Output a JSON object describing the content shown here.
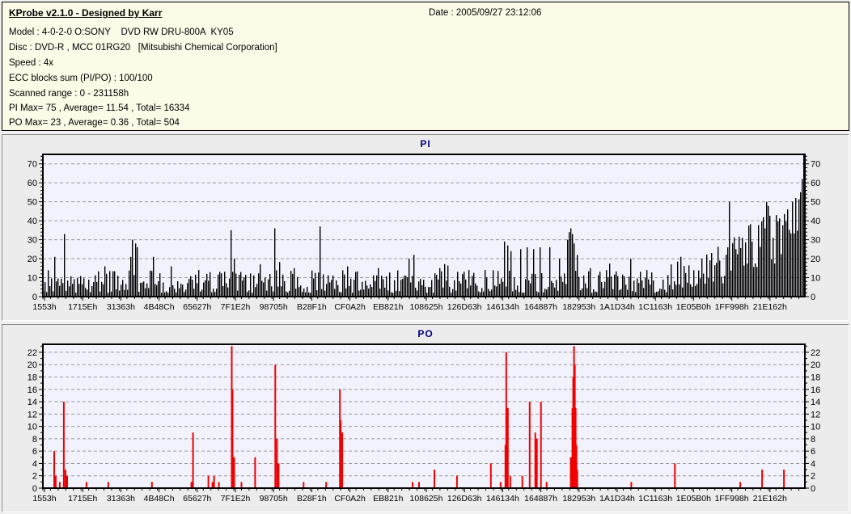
{
  "window": {
    "title": "KProbe v2.1.0 - Designed by Karr",
    "date_label": "Date : 2005/09/27 23:12:06"
  },
  "info": {
    "model": "Model : 4-0-2-0 O:SONY    DVD RW DRU-800A  KY05",
    "disc": "Disc : DVD-R , MCC 01RG20   [Mitsubishi Chemical Corporation]",
    "speed": "Speed : 4x",
    "ecc": "ECC blocks sum (PI/PO) : 100/100",
    "range": "Scanned range : 0 - 231158h",
    "pi_summary": "PI Max= 75 , Average= 11.54 , Total= 16334",
    "po_summary": "PO Max= 23 , Average= 0.36 , Total= 504"
  },
  "colors": {
    "info_bg": "#fbfbe7",
    "panel_bg": "#ececec",
    "plot_bg": "#f2f2fc",
    "grid": "#999999",
    "frame": "#000000",
    "title_navy": "#000080",
    "pi_bar": "#000000",
    "po_bar": "#f20000"
  },
  "chart_data": [
    {
      "type": "bar",
      "title": "PI",
      "bar_color": "#000000",
      "plot_bg": "#f2f2fc",
      "grid_color": "#999999",
      "ylim": [
        0,
        75
      ],
      "y_major_ticks": [
        0,
        10,
        20,
        30,
        40,
        50,
        60,
        70
      ],
      "y_minor_step": 2,
      "x_tick_labels": [
        "1553h",
        "1715Eh",
        "31363h",
        "4B48Ch",
        "65627h",
        "7F1E2h",
        "98705h",
        "B28F1h",
        "CF0A2h",
        "EB821h",
        "108625h",
        "126D63h",
        "146134h",
        "164887h",
        "182953h",
        "1A1D34h",
        "1C1163h",
        "1E05B0h",
        "1FF998h",
        "21E162h"
      ],
      "stats": {
        "max": 75,
        "average": 11.54,
        "total": 16334
      },
      "bar_count": 471,
      "noise_seed": 20050927,
      "burst_chance": 0.04,
      "burst_extra": 7,
      "baseline_segments": [
        {
          "from": 0.0,
          "to": 0.82,
          "min": [
            2,
            2
          ],
          "max": [
            14,
            14
          ],
          "pow": 1.4
        },
        {
          "from": 0.82,
          "to": 0.9,
          "min": [
            3,
            7
          ],
          "max": [
            16,
            30
          ],
          "pow": 1.1
        },
        {
          "from": 0.9,
          "to": 1.0,
          "min": [
            7,
            22
          ],
          "max": [
            32,
            55
          ],
          "pow": 0.9
        }
      ],
      "spikes": [
        [
          0.015,
          21
        ],
        [
          0.027,
          33
        ],
        [
          0.08,
          16
        ],
        [
          0.114,
          21
        ],
        [
          0.118,
          30
        ],
        [
          0.121,
          28
        ],
        [
          0.123,
          26
        ],
        [
          0.145,
          21
        ],
        [
          0.169,
          16
        ],
        [
          0.205,
          14
        ],
        [
          0.246,
          35
        ],
        [
          0.252,
          20
        ],
        [
          0.286,
          17
        ],
        [
          0.305,
          36
        ],
        [
          0.33,
          15
        ],
        [
          0.364,
          37
        ],
        [
          0.4,
          16
        ],
        [
          0.44,
          15
        ],
        [
          0.48,
          20
        ],
        [
          0.487,
          22
        ],
        [
          0.522,
          15
        ],
        [
          0.56,
          14
        ],
        [
          0.581,
          14
        ],
        [
          0.607,
          29
        ],
        [
          0.61,
          27
        ],
        [
          0.615,
          24
        ],
        [
          0.628,
          25
        ],
        [
          0.636,
          26
        ],
        [
          0.644,
          25
        ],
        [
          0.653,
          26
        ],
        [
          0.666,
          26
        ],
        [
          0.678,
          20
        ],
        [
          0.689,
          30
        ],
        [
          0.692,
          34
        ],
        [
          0.694,
          36
        ],
        [
          0.696,
          33
        ],
        [
          0.698,
          28
        ],
        [
          0.703,
          22
        ],
        [
          0.719,
          15
        ],
        [
          0.74,
          14
        ],
        [
          0.773,
          20
        ],
        [
          0.793,
          14
        ],
        [
          0.825,
          17
        ],
        [
          0.839,
          21
        ],
        [
          0.867,
          20
        ],
        [
          0.878,
          23
        ],
        [
          0.889,
          19
        ],
        [
          0.899,
          26
        ],
        [
          0.902,
          50
        ],
        [
          0.91,
          25
        ],
        [
          0.92,
          31
        ],
        [
          0.931,
          29
        ],
        [
          0.95,
          50
        ],
        [
          0.963,
          43
        ],
        [
          0.979,
          46
        ],
        [
          0.989,
          52
        ],
        [
          0.995,
          55
        ],
        [
          0.997,
          62
        ],
        [
          0.999,
          75
        ]
      ]
    },
    {
      "type": "bar",
      "title": "PO",
      "bar_color": "#f20000",
      "plot_bg": "#f2f2fc",
      "grid_color": "#999999",
      "ylim": [
        0,
        23.3
      ],
      "y_major_ticks": [
        0,
        2,
        4,
        6,
        8,
        10,
        12,
        14,
        16,
        18,
        20,
        22
      ],
      "y_minor_step": 1,
      "x_tick_labels": [
        "1553h",
        "1715Eh",
        "31363h",
        "4B48Ch",
        "65627h",
        "7F1E2h",
        "98705h",
        "B28F1h",
        "CF0A2h",
        "EB821h",
        "108625h",
        "126D63h",
        "146134h",
        "164887h",
        "182953h",
        "1A1D34h",
        "1C1163h",
        "1E05B0h",
        "1FF998h",
        "21E162h"
      ],
      "stats": {
        "max": 23,
        "average": 0.36,
        "total": 504
      },
      "bars": [
        [
          0.0138,
          6
        ],
        [
          0.0159,
          2
        ],
        [
          0.0212,
          1
        ],
        [
          0.0265,
          14
        ],
        [
          0.0287,
          3
        ],
        [
          0.0308,
          2
        ],
        [
          0.0563,
          1
        ],
        [
          0.0849,
          1
        ],
        [
          0.1423,
          1
        ],
        [
          0.1943,
          1
        ],
        [
          0.1964,
          9
        ],
        [
          0.2166,
          2
        ],
        [
          0.2219,
          1
        ],
        [
          0.224,
          2
        ],
        [
          0.2304,
          1
        ],
        [
          0.2473,
          23
        ],
        [
          0.2484,
          16
        ],
        [
          0.2505,
          5
        ],
        [
          0.2601,
          1
        ],
        [
          0.2781,
          5
        ],
        [
          0.3046,
          20
        ],
        [
          0.3068,
          8
        ],
        [
          0.3089,
          4
        ],
        [
          0.3418,
          1
        ],
        [
          0.3715,
          1
        ],
        [
          0.3896,
          16
        ],
        [
          0.3906,
          11
        ],
        [
          0.3927,
          9
        ],
        [
          0.4851,
          1
        ],
        [
          0.4936,
          1
        ],
        [
          0.5138,
          3
        ],
        [
          0.5435,
          2
        ],
        [
          0.5881,
          4
        ],
        [
          0.6008,
          1
        ],
        [
          0.6072,
          7
        ],
        [
          0.6083,
          22
        ],
        [
          0.6104,
          13
        ],
        [
          0.6136,
          2
        ],
        [
          0.6295,
          2
        ],
        [
          0.6391,
          14
        ],
        [
          0.6465,
          9
        ],
        [
          0.6486,
          8
        ],
        [
          0.6539,
          14
        ],
        [
          0.6614,
          1
        ],
        [
          0.6932,
          5
        ],
        [
          0.6953,
          13
        ],
        [
          0.6964,
          18
        ],
        [
          0.6975,
          23
        ],
        [
          0.6985,
          20
        ],
        [
          0.6996,
          13
        ],
        [
          0.7006,
          7
        ],
        [
          0.7017,
          3
        ],
        [
          0.7728,
          1
        ],
        [
          0.8301,
          4
        ],
        [
          0.9161,
          1
        ],
        [
          0.9448,
          3
        ],
        [
          0.9735,
          3
        ]
      ]
    }
  ]
}
